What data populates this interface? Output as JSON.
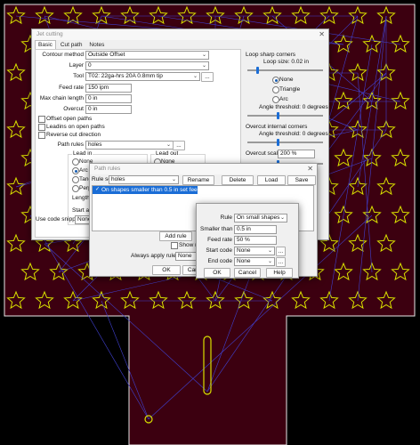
{
  "main_window": {
    "title": "Jet cutting",
    "tabs": [
      "Basic",
      "Cut path",
      "Notes"
    ],
    "contour_method": {
      "label": "Contour method",
      "value": "Outside Offset"
    },
    "layer": {
      "label": "Layer",
      "value": "0"
    },
    "tool": {
      "label": "Tool",
      "value": "T02: 22ga-hrs 20A 0.8mm tip"
    },
    "feed_rate": {
      "label": "Feed rate",
      "value": "150 ipm"
    },
    "max_chain_length": {
      "label": "Max chain length",
      "value": "0 in"
    },
    "overcut": {
      "label": "Overcut",
      "value": "0 in"
    },
    "offset_open_paths": "Offset open paths",
    "leadins_open_paths": "Leadins on open paths",
    "reverse_cut_direction": "Reverse cut direction",
    "path_rules": {
      "label": "Path rules",
      "value": "holes"
    },
    "lead_in": {
      "label": "Lead in",
      "options": [
        "None",
        "Arc",
        "Tange",
        "Perpe"
      ],
      "length_label": "Length"
    },
    "lead_out": {
      "label": "Lead out",
      "options": [
        "None"
      ]
    },
    "start_at": "Start at th",
    "use_code_snippet": {
      "label": "Use code snippet",
      "value": "None"
    },
    "loop_sharp_corners": {
      "title": "Loop sharp corners",
      "loop_size": "Loop size: 0.02 in",
      "options": [
        "None",
        "Triangle",
        "Arc"
      ],
      "angle_threshold": "Angle threshold: 0 degrees"
    },
    "overcut_internal_corners": {
      "title": "Overcut internal corners",
      "angle_threshold": "Angle threshold: 0 degrees",
      "scale_label": "Overcut scale",
      "scale_value": "200 %"
    },
    "ellipsis": "..."
  },
  "path_rules_window": {
    "title": "Path rules",
    "rule_set_label": "Rule set",
    "rule_set_value": "holes",
    "buttons": {
      "rename": "Rename",
      "delete": "Delete",
      "load": "Load",
      "save": "Save",
      "add_rule": "Add rule",
      "ok": "OK",
      "cancel": "Cancel"
    },
    "rule_item": "On shapes smaller than 0.5 in set feed to 50 %",
    "show_rule_label": "Show rul",
    "always_apply_label": "Always apply rule set",
    "always_apply_value": "None"
  },
  "rule_dialog": {
    "rule": {
      "label": "Rule",
      "value": "On small shapes"
    },
    "smaller_than": {
      "label": "Smaller than",
      "value": "0.5 in"
    },
    "feed_rate": {
      "label": "Feed rate",
      "value": "50 %"
    },
    "start_code": {
      "label": "Start code",
      "value": "None"
    },
    "end_code": {
      "label": "End code",
      "value": "None"
    },
    "ellipsis": "...",
    "buttons": {
      "ok": "OK",
      "cancel": "Cancel",
      "help": "Help"
    }
  },
  "colors": {
    "background": "#000000",
    "material": "#3c0010",
    "part_outline": "#e8e8e8",
    "toolpath": "#4040d0",
    "hole_outline": "#d8e000",
    "accent": "#1a6dd6"
  }
}
